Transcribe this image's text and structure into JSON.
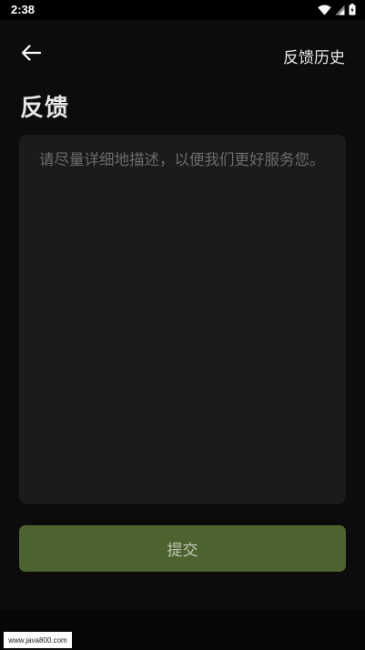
{
  "status_bar": {
    "time": "2:38",
    "icons": [
      "wifi-icon",
      "signal-icon",
      "battery-icon"
    ]
  },
  "app_bar": {
    "back_icon": "arrow-left-icon",
    "history_label": "反馈历史"
  },
  "page": {
    "title": "反馈"
  },
  "feedback": {
    "value": "",
    "placeholder": "请尽量详细地描述，以便我们更好服务您。"
  },
  "submit": {
    "label": "提交"
  },
  "watermark": {
    "text": "www.java800.com"
  },
  "colors": {
    "background": "#0c0c0c",
    "input_background": "#1b1b1b",
    "submit_background": "#4c6330",
    "placeholder": "#6c6c6c"
  }
}
